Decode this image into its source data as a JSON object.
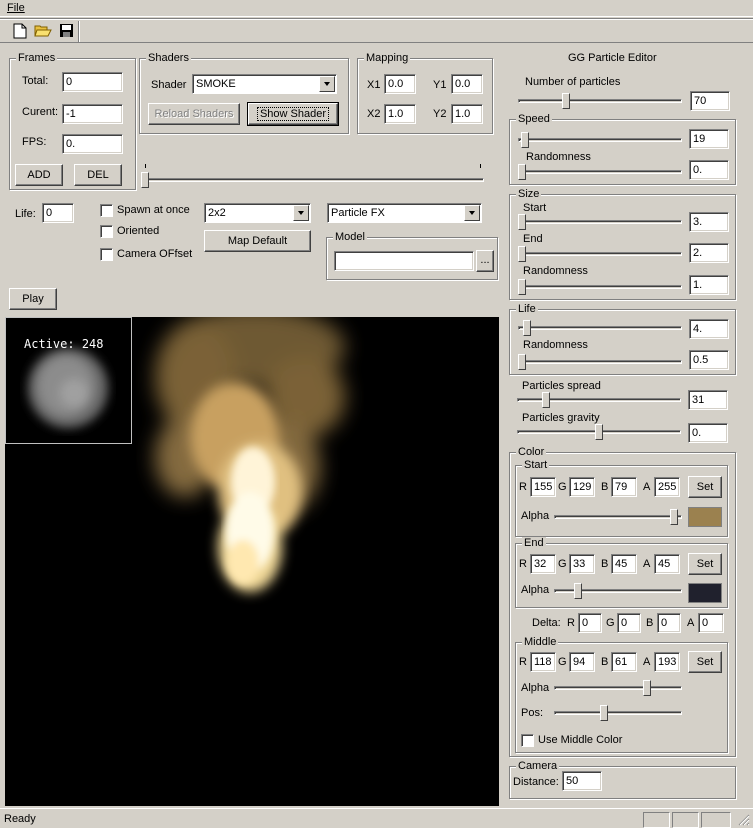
{
  "menu": {
    "file": "File"
  },
  "toolbar": {
    "icons": [
      "new-file-icon",
      "open-folder-icon",
      "save-icon"
    ]
  },
  "frames": {
    "legend": "Frames",
    "total_label": "Total:",
    "total": "0",
    "current_label": "Curent:",
    "current": "-1",
    "fps_label": "FPS:",
    "fps": "0.",
    "add": "ADD",
    "del": "DEL"
  },
  "shaders": {
    "legend": "Shaders",
    "shader_label": "Shader",
    "shader": "SMOKE",
    "reload": "Reload Shaders",
    "show": "Show Shader"
  },
  "mapping": {
    "legend": "Mapping",
    "x1_label": "X1",
    "x1": "0.0",
    "y1_label": "Y1",
    "y1": "0.0",
    "x2_label": "X2",
    "x2": "1.0",
    "y2_label": "Y2",
    "y2": "1.0"
  },
  "timeline": {
    "position": 0.0
  },
  "life_label": "Life:",
  "life": "0",
  "options": {
    "spawn": "Spawn at once",
    "oriented": "Oriented",
    "camera_offset": "Camera OFfset",
    "grid": "2x2",
    "map_default": "Map Default",
    "fx_type": "Particle FX"
  },
  "model": {
    "legend": "Model",
    "value": "",
    "browse": "..."
  },
  "play": "Play",
  "viewport": {
    "active_label": "Active:",
    "active_count": "248"
  },
  "editor": {
    "title": "GG Particle Editor",
    "num_particles_label": "Number of particles",
    "num_particles": "70",
    "num_particles_pos": 0.28,
    "speed": {
      "legend": "Speed",
      "value": "19",
      "pos": 0.02,
      "rand_label": "Randomness",
      "rand": "0.",
      "rand_pos": 0.0
    },
    "size": {
      "legend": "Size",
      "start_label": "Start",
      "start": "3.",
      "start_pos": 0.0,
      "end_label": "End",
      "end": "2.",
      "end_pos": 0.0,
      "rand_label": "Randomness",
      "rand": "1.",
      "rand_pos": 0.0
    },
    "life": {
      "legend": "Life",
      "value": "4.",
      "pos": 0.03,
      "rand_label": "Randomness",
      "rand": "0.5",
      "rand_pos": 0.0
    },
    "spread_label": "Particles spread",
    "spread": "31",
    "spread_pos": 0.16,
    "gravity_label": "Particles gravity",
    "gravity": "0.",
    "gravity_pos": 0.5,
    "color": {
      "legend": "Color",
      "start": {
        "legend": "Start",
        "r": "155",
        "g": "129",
        "b": "79",
        "a": "255",
        "alpha_pos": 0.97,
        "swatch": "#9b814f"
      },
      "end": {
        "legend": "End",
        "r": "32",
        "g": "33",
        "b": "45",
        "a": "45",
        "alpha_pos": 0.17,
        "swatch": "#20212d"
      },
      "delta": {
        "label": "Delta:",
        "r": "0",
        "g": "0",
        "b": "0",
        "a": "0"
      },
      "middle": {
        "legend": "Middle",
        "r": "118",
        "g": "94",
        "b": "61",
        "a": "193",
        "alpha_pos": 0.74,
        "pos_label": "Pos:",
        "pos_pos": 0.38,
        "use": "Use Middle Color"
      },
      "r": "R",
      "g": "G",
      "b": "B",
      "a": "A",
      "set": "Set",
      "alpha_label": "Alpha"
    },
    "camera": {
      "legend": "Camera",
      "distance_label": "Distance:",
      "distance": "50"
    }
  },
  "status": "Ready"
}
